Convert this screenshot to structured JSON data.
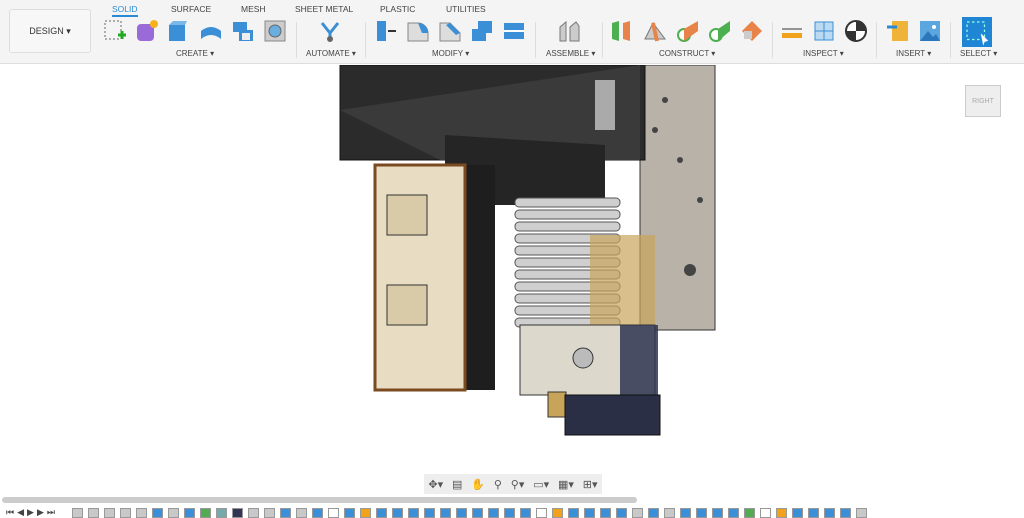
{
  "design_label": "DESIGN ▾",
  "tabs": [
    "SOLID",
    "SURFACE",
    "MESH",
    "SHEET METAL",
    "PLASTIC",
    "UTILITIES"
  ],
  "groups": [
    "CREATE ▾",
    "AUTOMATE ▾",
    "MODIFY ▾",
    "ASSEMBLE ▾",
    "CONSTRUCT ▾",
    "INSPECT ▾",
    "INSERT ▾",
    "SELECT ▾"
  ],
  "viewcube_label": "RIGHT",
  "nav": [
    "✥▾",
    "▤",
    "✋",
    "⚲",
    "⚲▾",
    "▭▾",
    "▦▾",
    "⊞▾"
  ],
  "timeline_controls": [
    "⏮",
    "◀",
    "▶",
    "▶",
    "⏭"
  ],
  "timeline": [
    "g",
    "g",
    "g",
    "g",
    "g",
    "b",
    "g",
    "b",
    "p",
    "a",
    "d",
    "g",
    "g",
    "b",
    "g",
    "b",
    "s",
    "b",
    "o",
    "b",
    "b",
    "b",
    "b",
    "b",
    "b",
    "b",
    "b",
    "b",
    "b",
    "s",
    "o",
    "b",
    "b",
    "b",
    "b",
    "g",
    "b",
    "g",
    "b",
    "b",
    "b",
    "b",
    "p",
    "s",
    "o",
    "b",
    "b",
    "b",
    "b",
    "g"
  ]
}
